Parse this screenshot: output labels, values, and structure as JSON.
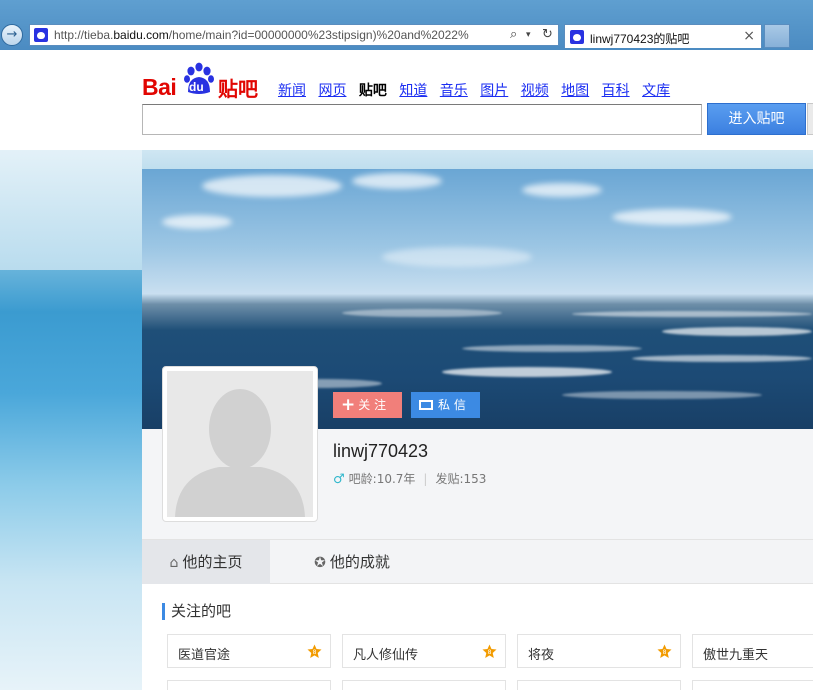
{
  "browser": {
    "url_prefix": "http://tieba.",
    "url_domain": "baidu.com",
    "url_rest": "/home/main?id=00000000%23stipsign)%20and%2022%",
    "tab_title": "linwj770423的贴吧",
    "tab_close": "×"
  },
  "header": {
    "logo_bai": "Bai",
    "logo_du": "du",
    "logo_tieba": "贴吧",
    "nav": [
      "新闻",
      "网页",
      "贴吧",
      "知道",
      "音乐",
      "图片",
      "视频",
      "地图",
      "百科",
      "文库"
    ],
    "nav_current": "贴吧",
    "search_button": "进入贴吧"
  },
  "profile": {
    "follow_label": "关 注",
    "message_label": "私 信",
    "username": "linwj770423",
    "age": "吧龄:10.7年",
    "posts": "发贴:153"
  },
  "tabs": {
    "home": "他的主页",
    "achievements": "他的成就"
  },
  "followed": {
    "title": "关注的吧",
    "bars": [
      "医道官途",
      "凡人修仙传",
      "将夜",
      "傲世九重天"
    ],
    "level_badge_color": "#f29b00"
  },
  "colors": {
    "brand_red": "#e10602",
    "brand_blue": "#2932e1",
    "follow_button": "#f17f7a",
    "message_button": "#3c8ae3"
  }
}
